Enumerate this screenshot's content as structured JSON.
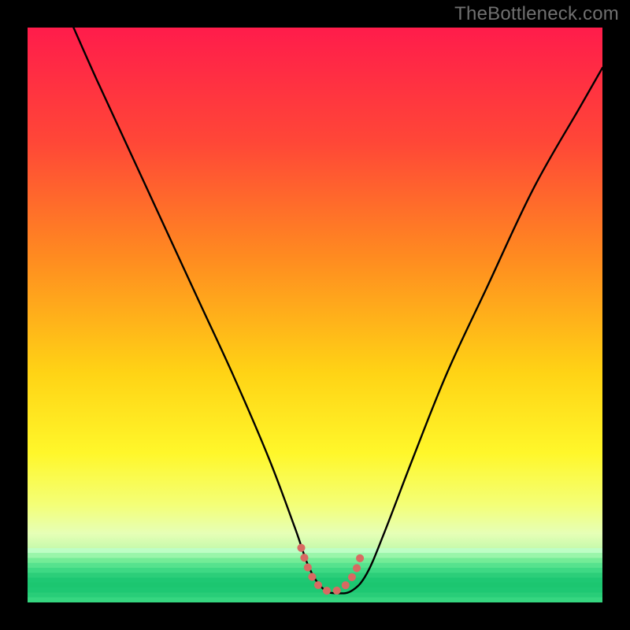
{
  "watermark": "TheBottleneck.com",
  "chart_data": {
    "type": "line",
    "title": "",
    "xlabel": "",
    "ylabel": "",
    "xlim": [
      0,
      100
    ],
    "ylim": [
      0,
      100
    ],
    "grid": false,
    "legend": false,
    "series": [
      {
        "name": "bottleneck-curve",
        "color": "#000000",
        "x": [
          8,
          12,
          18,
          24,
          30,
          36,
          42,
          46.5,
          49,
          51.5,
          54,
          56.5,
          59,
          62,
          67,
          73,
          80,
          88,
          96,
          100
        ],
        "y": [
          100,
          91,
          78,
          65,
          52,
          39,
          25,
          13,
          6,
          2.3,
          1.6,
          2.1,
          5,
          12,
          25,
          40,
          55,
          72,
          86,
          93
        ]
      },
      {
        "name": "highlight-segment",
        "color": "#d86a62",
        "x": [
          47.6,
          48.7,
          49.9,
          51.2,
          52.6,
          53.9,
          55.1,
          56.3,
          57.4,
          58.2
        ],
        "y": [
          9.5,
          6.2,
          3.8,
          2.5,
          1.9,
          2.1,
          2.8,
          4.2,
          6.3,
          9.2
        ]
      }
    ],
    "background_gradient": {
      "stops": [
        {
          "pos": 0.0,
          "color": "#ff1c4b"
        },
        {
          "pos": 0.2,
          "color": "#ff4737"
        },
        {
          "pos": 0.4,
          "color": "#ff8b20"
        },
        {
          "pos": 0.6,
          "color": "#ffd315"
        },
        {
          "pos": 0.74,
          "color": "#fff72a"
        },
        {
          "pos": 0.83,
          "color": "#f4ff77"
        },
        {
          "pos": 0.88,
          "color": "#e6ffb6"
        },
        {
          "pos": 0.92,
          "color": "#b6f7a6"
        },
        {
          "pos": 0.96,
          "color": "#5fe28a"
        },
        {
          "pos": 1.0,
          "color": "#22c86f"
        }
      ]
    }
  }
}
